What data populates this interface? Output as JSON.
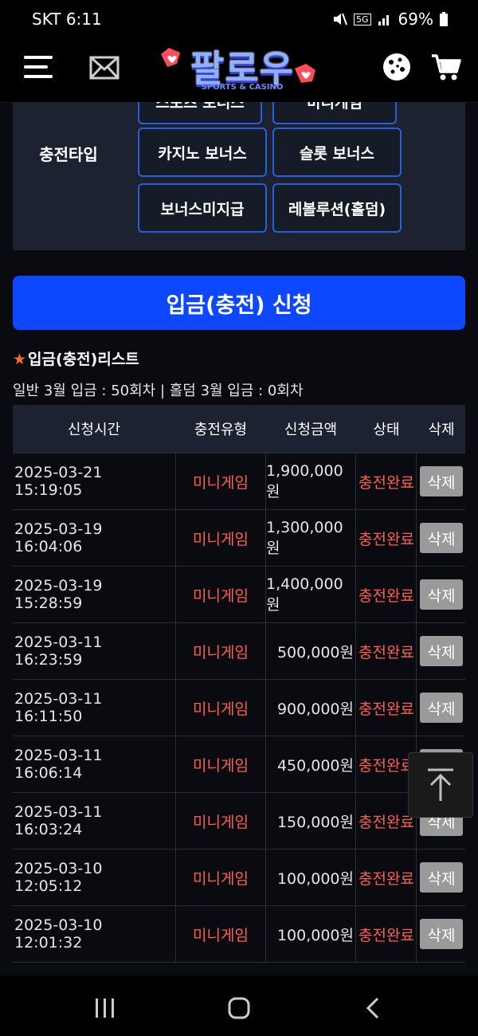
{
  "status_bar": {
    "carrier_time": "SKT 6:11",
    "battery": "69%",
    "network": "5G"
  },
  "header": {
    "logo_text": "팔로우",
    "logo_subtitle": "SPORTS & CASINO",
    "icons": [
      "menu-icon",
      "mail-icon",
      "cookie-icon",
      "cart-icon"
    ]
  },
  "charge_panel": {
    "label": "충전타입",
    "types": [
      "스포츠 보너스",
      "미니게임",
      "카지노 보너스",
      "슬롯 보너스",
      "보너스미지급",
      "레볼루션(홀덤)"
    ]
  },
  "apply_button": "입금(충전) 신청",
  "list": {
    "title": "입금(충전)리스트",
    "summary": "일반 3월 입금 : 50회차 | 홀덤 3월 입금 : 0회차",
    "columns": [
      "신청시간",
      "충전유형",
      "신청금액",
      "상태",
      "삭제"
    ],
    "rows": [
      {
        "time": "2025-03-21 15:19:05",
        "type": "미니게임",
        "amount": "1,900,000원",
        "status": "충전완료",
        "action": "삭제"
      },
      {
        "time": "2025-03-19 16:04:06",
        "type": "미니게임",
        "amount": "1,300,000원",
        "status": "충전완료",
        "action": "삭제"
      },
      {
        "time": "2025-03-19 15:28:59",
        "type": "미니게임",
        "amount": "1,400,000원",
        "status": "충전완료",
        "action": "삭제"
      },
      {
        "time": "2025-03-11 16:23:59",
        "type": "미니게임",
        "amount": "500,000원",
        "status": "충전완료",
        "action": "삭제"
      },
      {
        "time": "2025-03-11 16:11:50",
        "type": "미니게임",
        "amount": "900,000원",
        "status": "충전완료",
        "action": "삭제"
      },
      {
        "time": "2025-03-11 16:06:14",
        "type": "미니게임",
        "amount": "450,000원",
        "status": "충전완료",
        "action": "삭제"
      },
      {
        "time": "2025-03-11 16:03:24",
        "type": "미니게임",
        "amount": "150,000원",
        "status": "충전완료",
        "action": "삭제"
      },
      {
        "time": "2025-03-10 12:05:12",
        "type": "미니게임",
        "amount": "100,000원",
        "status": "충전완료",
        "action": "삭제"
      },
      {
        "time": "2025-03-10 12:01:32",
        "type": "미니게임",
        "amount": "100,000원",
        "status": "충전완료",
        "action": "삭제"
      }
    ]
  },
  "colors": {
    "accent": "#0d47ff",
    "status_red": "#ff5e4e",
    "panel": "#1c2230",
    "delete_gray": "#9a9a9a"
  }
}
